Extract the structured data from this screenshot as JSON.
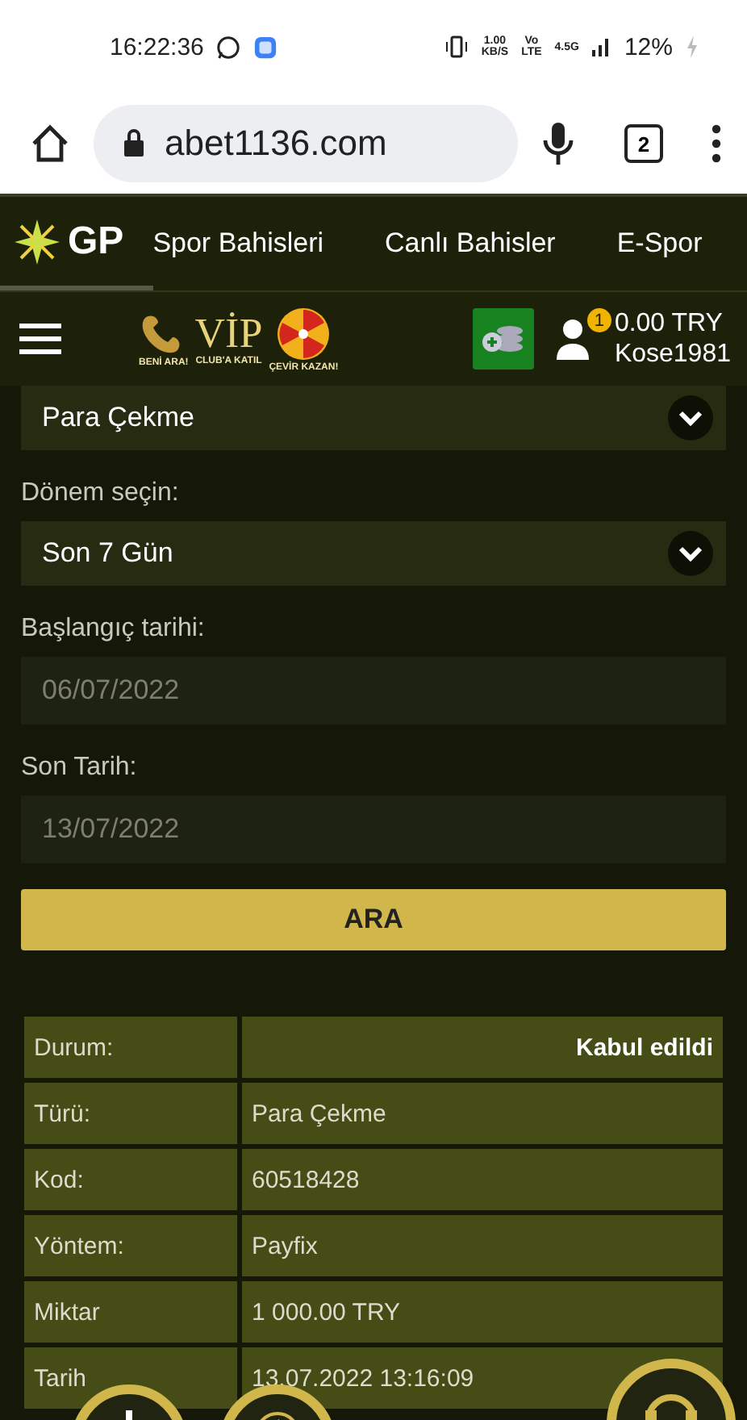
{
  "status_bar": {
    "time": "16:22:36",
    "speed": "1.00",
    "speed_unit": "KB/S",
    "volte_top": "Vo",
    "volte_bottom": "LTE",
    "network": "4.5G",
    "battery": "12%"
  },
  "browser": {
    "url": "abet1136.com",
    "tab_count": "2"
  },
  "nav": {
    "logo": "GP",
    "items": [
      "Spor Bahisleri",
      "Canlı Bahisler",
      "E-Spor"
    ]
  },
  "header": {
    "promos": [
      {
        "kind": "phone",
        "label": "BENİ ARA!"
      },
      {
        "kind": "vip",
        "title": "VİP",
        "label": "CLUB'A KATIL"
      },
      {
        "kind": "wheel",
        "label": "ÇEVİR KAZAN!"
      }
    ],
    "badge": "1",
    "balance": "0.00 TRY",
    "username": "Kose1981"
  },
  "form": {
    "fields": [
      {
        "kind": "select",
        "value": "Para Çekme"
      },
      {
        "kind": "select",
        "label": "Dönem seçin:",
        "value": "Son 7 Gün"
      },
      {
        "kind": "date",
        "label": "Başlangıç tarihi:",
        "value": "06/07/2022",
        "disabled": true
      },
      {
        "kind": "date",
        "label": "Son Tarih:",
        "value": "13/07/2022",
        "disabled": true
      }
    ],
    "button": "ARA"
  },
  "table": {
    "rows": [
      {
        "kind": "status",
        "label": "Durum:",
        "value": "Kabul edildi"
      },
      {
        "kind": "text",
        "label": "Türü:",
        "value": "Para Çekme"
      },
      {
        "kind": "text",
        "label": "Kod:",
        "value": "60518428"
      },
      {
        "kind": "text",
        "label": "Yöntem:",
        "value": "Payfix"
      },
      {
        "kind": "text",
        "label": "Miktar",
        "value": "1 000.00 TRY"
      },
      {
        "kind": "text",
        "label": "Tarih",
        "value": "13.07.2022 13:16:09"
      }
    ]
  }
}
